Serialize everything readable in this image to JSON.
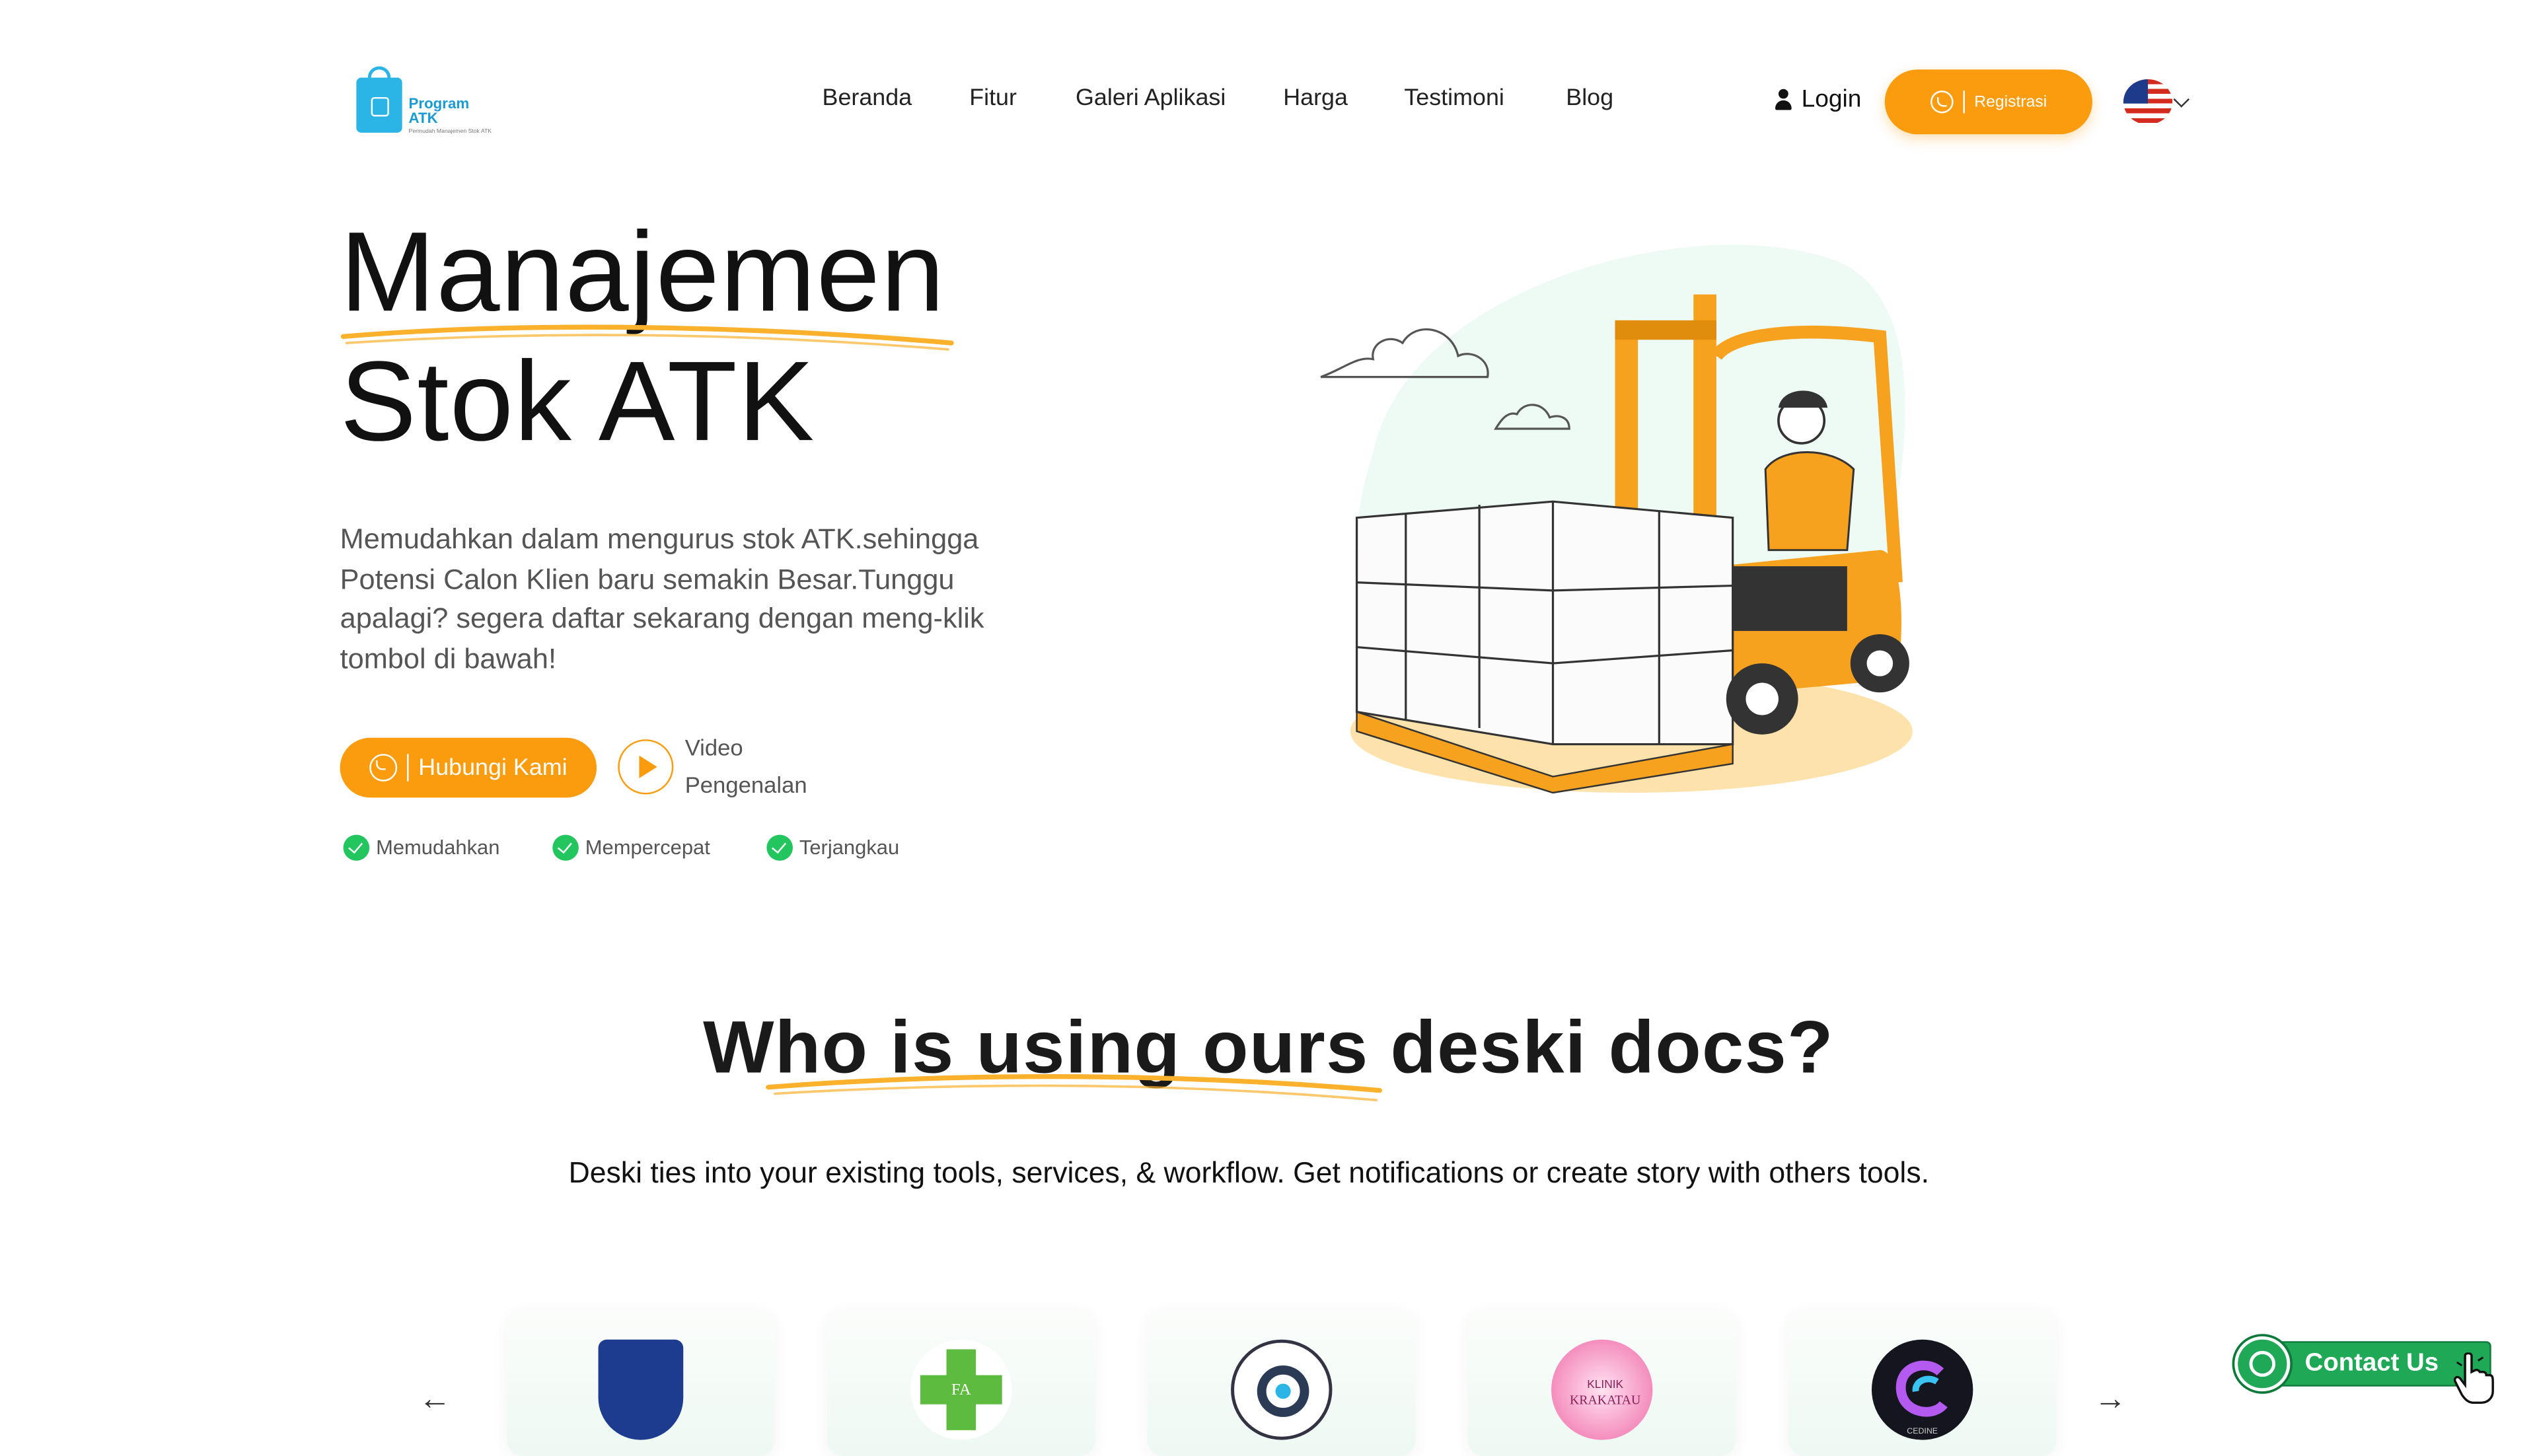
{
  "header": {
    "logo": {
      "line1": "Program",
      "line2": "ATK",
      "tagline": "Permudah Manajemen Stok ATK"
    },
    "nav": [
      "Beranda",
      "Fitur",
      "Galeri Aplikasi",
      "Harga",
      "Testimoni",
      "Blog"
    ],
    "login_label": "Login",
    "register_label": "Registrasi",
    "language": "en-us-flag-icon"
  },
  "hero": {
    "title_line1": "Manajemen",
    "title_line2": "Stok ATK",
    "description": "Memudahkan dalam mengurus stok ATK.sehingga Potensi Calon Klien baru semakin Besar.Tunggu apalagi? segera daftar sekarang dengan meng-klik tombol di bawah!",
    "contact_button": "Hubungi Kami",
    "video_label_1": "Video",
    "video_label_2": "Pengenalan",
    "features": [
      "Memudahkan",
      "Mempercepat",
      "Terjangkau"
    ]
  },
  "clients": {
    "title": "Who is using ours deski docs?",
    "subtitle": "Deski ties into your existing tools, services, & workflow. Get notifications or create story with others tools.",
    "logos": [
      "Surabaya city emblem",
      "FA",
      "P",
      "KLINIK KRAKATAU",
      "CEDINE"
    ],
    "prev_arrow": "←",
    "next_arrow": "→"
  },
  "floating": {
    "contact_label": "Contact Us"
  },
  "colors": {
    "accent": "#fb9c0e",
    "whatsapp": "#1fa855",
    "check": "#22c55e"
  }
}
